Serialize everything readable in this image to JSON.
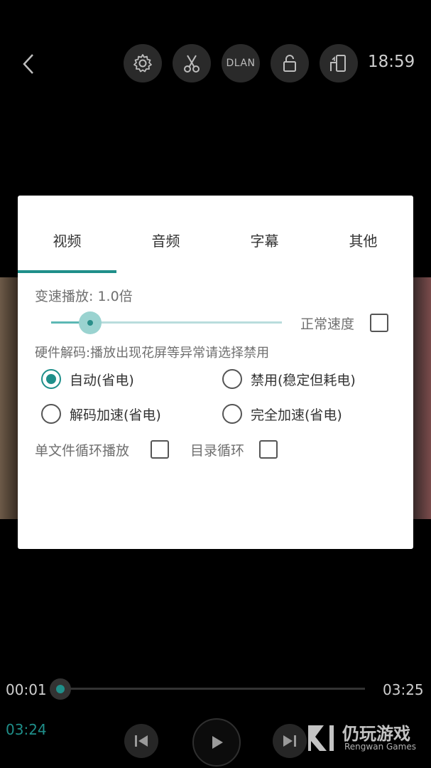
{
  "topbar": {
    "back_icon": "chevron-left-icon",
    "buttons": [
      {
        "name": "settings",
        "icon": "gear-icon"
      },
      {
        "name": "cut",
        "icon": "scissors-icon"
      },
      {
        "name": "dlan",
        "label": "DLAN"
      },
      {
        "name": "lock",
        "icon": "lock-icon"
      },
      {
        "name": "rotate",
        "icon": "rotate-screen-icon"
      }
    ],
    "clock": "18:59"
  },
  "dialog": {
    "tabs": [
      "视频",
      "音频",
      "字幕",
      "其他"
    ],
    "active_tab": 0,
    "speed": {
      "label": "变速播放: 1.0倍",
      "slider_fraction": 0.17,
      "normal_speed_label": "正常速度",
      "normal_speed_checked": false
    },
    "hw_decode": {
      "title": "硬件解码:播放出现花屏等异常请选择禁用",
      "options": [
        "自动(省电)",
        "禁用(稳定但耗电)",
        "解码加速(省电)",
        "完全加速(省电)"
      ],
      "selected": 0
    },
    "loop": {
      "single_file_label": "单文件循环播放",
      "single_file_checked": false,
      "directory_label": "目录循环",
      "directory_checked": false
    }
  },
  "player": {
    "current_time": "00:01",
    "total_time": "03:25",
    "hover_time": "03:24",
    "progress_fraction": 0.005
  },
  "watermark": {
    "text": "仍玩游戏",
    "sub": "Rengwan Games"
  },
  "colors": {
    "accent": "#1f8f8a",
    "slider_light": "#9ad3d0",
    "background": "#000000",
    "dialog_bg": "#ffffff"
  }
}
